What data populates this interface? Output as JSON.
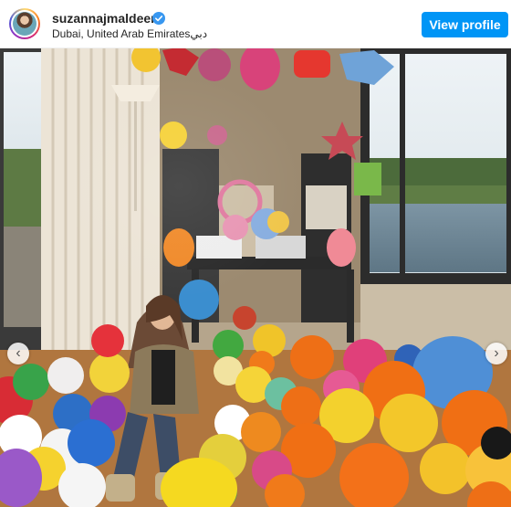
{
  "post": {
    "username": "suzannajmaldeen",
    "verified": true,
    "location": "Dubai, United Arab Emiratesدبي",
    "view_profile_label": "View profile"
  },
  "carousel": {
    "prev_glyph": "‹",
    "next_glyph": "›"
  },
  "icons": {
    "verified": "verified-badge-icon",
    "prev": "chevron-left-icon",
    "next": "chevron-right-icon"
  },
  "colors": {
    "button": "#0095f6",
    "verified": "#3897f0",
    "username": "#262626"
  }
}
